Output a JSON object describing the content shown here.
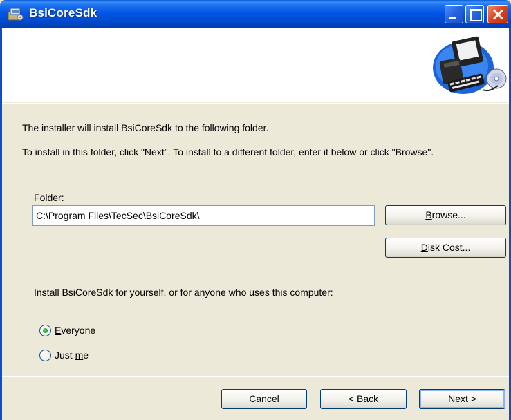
{
  "window": {
    "title": "BsiCoreSdk",
    "icon": "installer-package-icon",
    "controls": [
      "minimize-icon",
      "maximize-icon",
      "close-icon"
    ]
  },
  "banner": {
    "art_icon": "computer-with-cd-icon"
  },
  "instructions": {
    "line1": "The installer will install BsiCoreSdk to the following folder.",
    "line2": "To install in this folder, click \"Next\". To install to a different folder, enter it below or click \"Browse\"."
  },
  "folder": {
    "label_mnemonic": "F",
    "label_rest": "older:",
    "value": "C:\\Program Files\\TecSec\\BsiCoreSdk\\"
  },
  "buttons": {
    "browse_mnemonic": "B",
    "browse_rest": "rowse...",
    "diskcost_mnemonic": "D",
    "diskcost_rest": "isk Cost...",
    "cancel": "Cancel",
    "back_prefix": "< ",
    "back_mnemonic": "B",
    "back_rest": "ack",
    "next_mnemonic": "N",
    "next_rest": "ext >"
  },
  "install_for": {
    "prompt": "Install BsiCoreSdk for yourself, or for anyone who uses this computer:",
    "options": [
      {
        "mnemonic": "E",
        "rest": "veryone",
        "selected": true
      },
      {
        "prefix": "Just ",
        "mnemonic": "m",
        "rest": "e",
        "selected": false
      }
    ]
  },
  "colors": {
    "titlebar": "#0054e3",
    "dialog_bg": "#ece9d8",
    "close_button": "#d9431e",
    "radio_selected": "#21a121"
  }
}
